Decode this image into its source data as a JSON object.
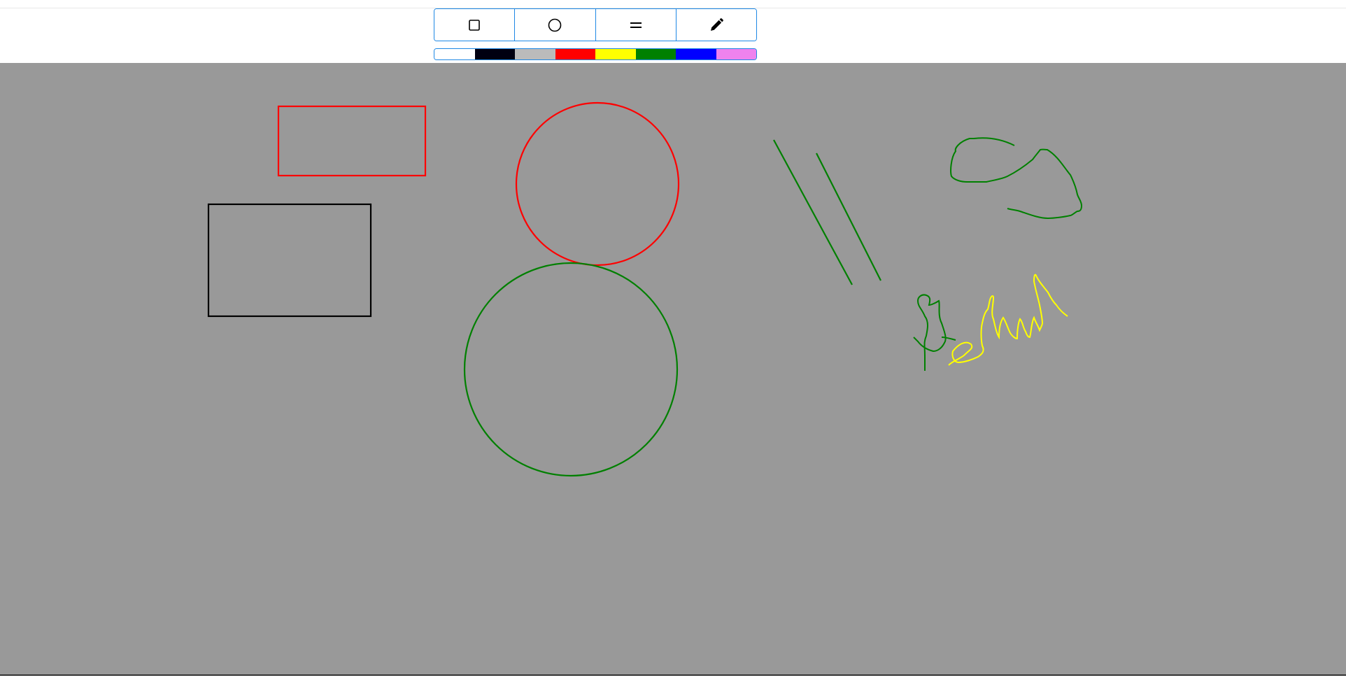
{
  "toolbar": {
    "tools": [
      {
        "id": "rectangle",
        "icon": "square-icon"
      },
      {
        "id": "circle",
        "icon": "circle-icon"
      },
      {
        "id": "line",
        "icon": "equals-icon"
      },
      {
        "id": "freehand",
        "icon": "pencil-icon"
      }
    ]
  },
  "palette": {
    "colors": [
      "#ffffff",
      "#000011",
      "#bbbbbb",
      "#ff0000",
      "#ffff00",
      "#008000",
      "#0000ff",
      "#ee82ee"
    ]
  },
  "canvas": {
    "background": "#999999"
  }
}
